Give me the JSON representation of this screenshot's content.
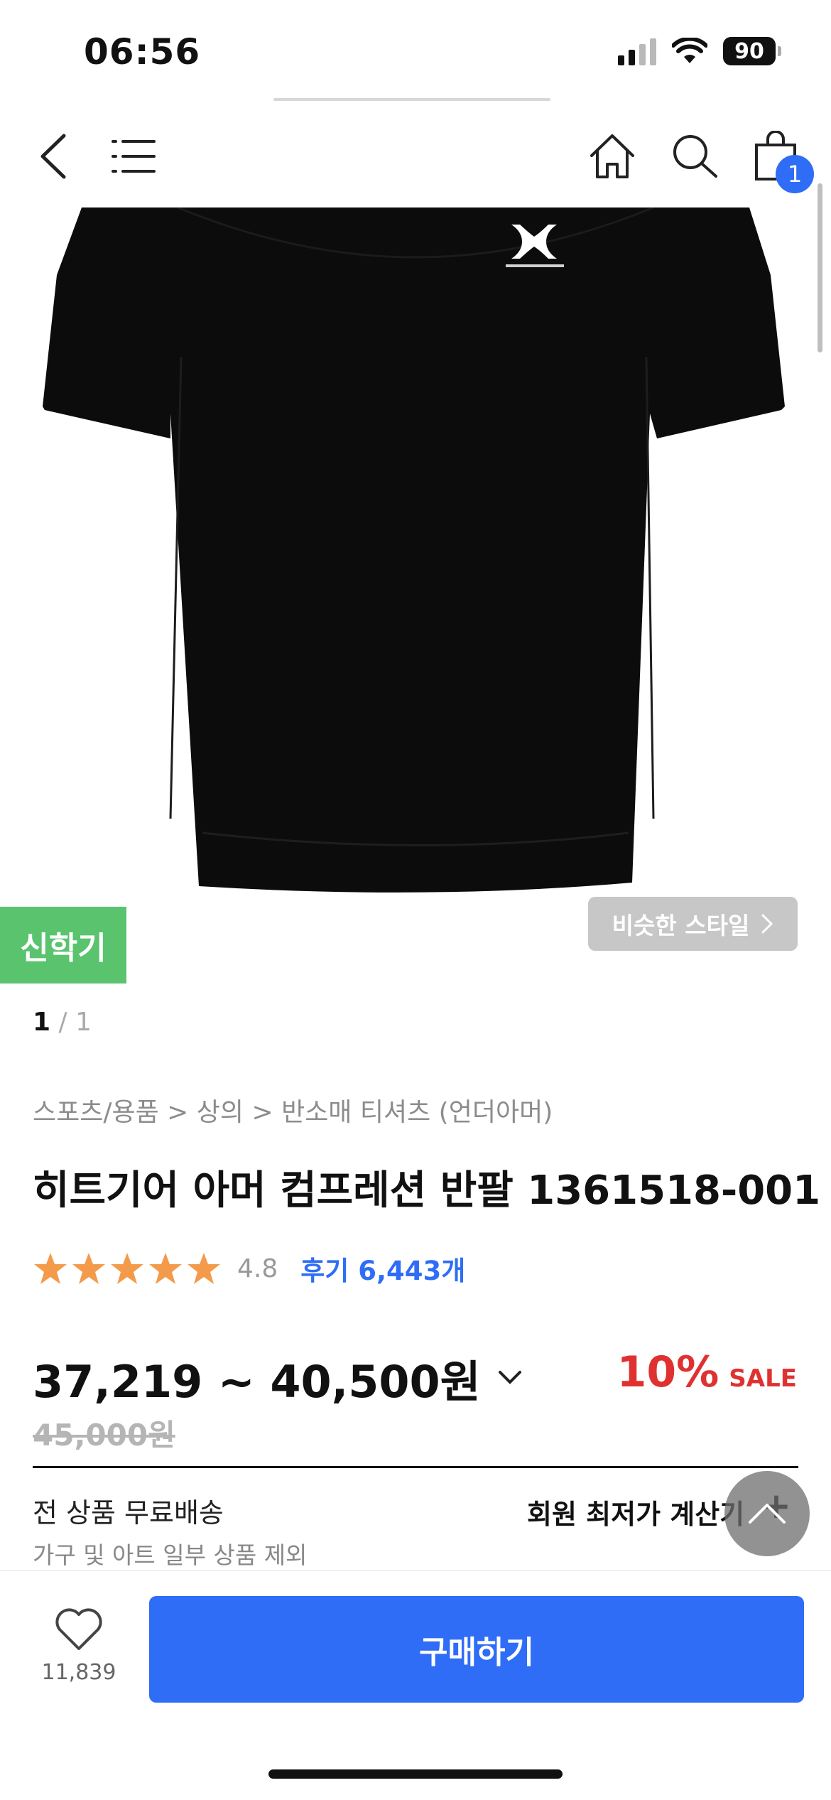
{
  "status_bar": {
    "time": "06:56",
    "battery": "90"
  },
  "nav": {
    "cart_count": "1"
  },
  "product": {
    "badge": "신학기",
    "similar_style": "비슷한 스타일",
    "pager_current": "1",
    "pager_sep_total": " / 1",
    "breadcrumb": "스포츠/용품 > 상의 > 반소매 티셔츠 (언더아머)",
    "title": "히트기어 아머 컴프레션 반팔 1361518-001",
    "rating": "4.8",
    "rating_stars": 5,
    "reviews": "후기 6,443개",
    "price_range": "37,219 ~ 40,500원",
    "original_price": "45,000원",
    "discount_pct": "10%",
    "discount_label": "SALE",
    "shipping_title": "전 상품 무료배송",
    "shipping_note": "가구 및 아트 일부 상품 제외",
    "member_price_link": "회원 최저가 계산기"
  },
  "bottom": {
    "likes": "11,839",
    "buy_label": "구매하기"
  },
  "colors": {
    "accent": "#2f6df6",
    "sale": "#e03131",
    "badge_green": "#5ac36e",
    "star": "#f39b4b"
  }
}
